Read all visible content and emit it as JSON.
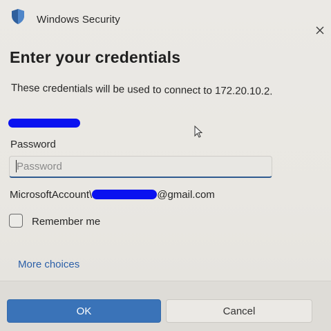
{
  "window": {
    "title": "Windows Security",
    "icons": {
      "app": "shield-icon",
      "close": "close-icon"
    }
  },
  "dialog": {
    "heading": "Enter your credentials",
    "description": "These credentials will be used to connect to 172.20.10.2.",
    "password_label": "Password",
    "password_placeholder": "Password",
    "account_prefix": "MicrosoftAccount\\",
    "account_suffix": "@gmail.com",
    "remember_label": "Remember me",
    "remember_checked": false,
    "more_choices": "More choices"
  },
  "buttons": {
    "ok": "OK",
    "cancel": "Cancel"
  },
  "colors": {
    "accent": "#3a73b8",
    "link": "#2b5fa8",
    "redaction": "#0a12f0"
  }
}
